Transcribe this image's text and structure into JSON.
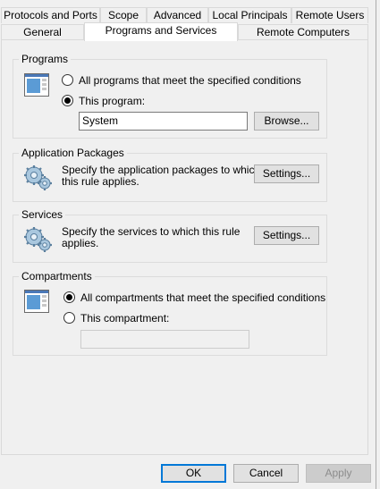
{
  "tabs_row1": [
    "Protocols and Ports",
    "Scope",
    "Advanced",
    "Local Principals",
    "Remote Users"
  ],
  "tabs_row2": [
    "General",
    "Programs and Services",
    "Remote Computers"
  ],
  "programs": {
    "title": "Programs",
    "option_all": "All programs that meet the specified conditions",
    "option_this": "This program:",
    "selected": "this",
    "program_value": "System",
    "browse_label": "Browse..."
  },
  "packages": {
    "title": "Application Packages",
    "description": "Specify the application packages to which this rule applies.",
    "desc_line1": "Specify the application packages to which",
    "desc_line2": "this rule applies.",
    "settings_label": "Settings..."
  },
  "services": {
    "title": "Services",
    "desc_line1": "Specify the services to which this rule",
    "desc_line2": "applies.",
    "settings_label": "Settings..."
  },
  "compartments": {
    "title": "Compartments",
    "option_all": "All compartments that meet the specified conditions",
    "option_this": "This compartment:",
    "selected": "all",
    "compartment_value": ""
  },
  "footer": {
    "ok_label": "OK",
    "cancel_label": "Cancel",
    "apply_label": "Apply",
    "apply_enabled": false
  },
  "icons": {
    "program": "program-window-icon",
    "packages": "gears-icon",
    "services": "gears-icon",
    "compartments": "compartment-window-icon"
  }
}
